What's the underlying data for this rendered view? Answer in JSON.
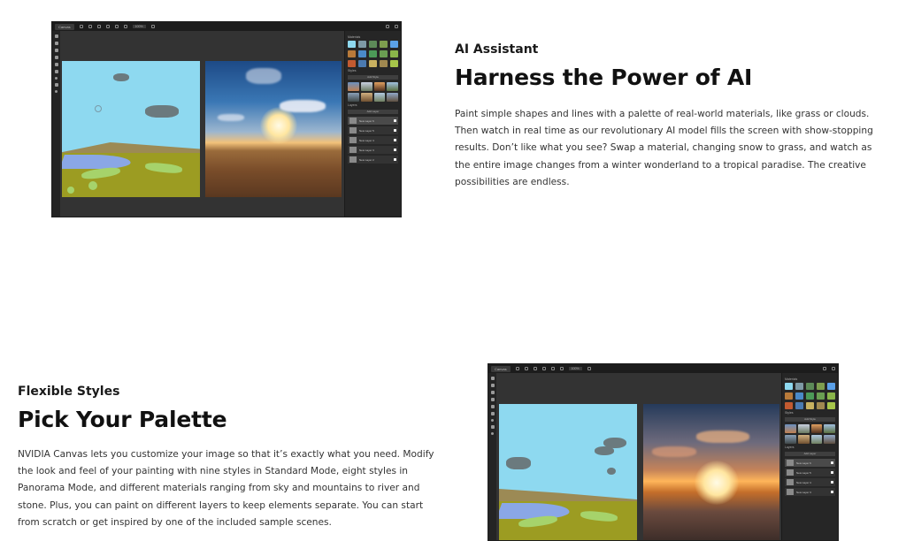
{
  "section1": {
    "eyebrow": "AI Assistant",
    "headline": "Harness the Power of AI",
    "body": "Paint simple shapes and lines with a palette of real-world materials, like grass or clouds. Then watch in real time as our revolutionary AI model fills the screen with show-stopping results. Don’t like what you see? Swap a material, changing snow to grass, and watch as the entire image changes from a winter wonderland to a tropical paradise. The creative possibilities are endless."
  },
  "section2": {
    "eyebrow": "Flexible Styles",
    "headline": "Pick Your Palette",
    "body": "NVIDIA Canvas lets you customize your image so that it’s exactly what you need. Modify the look and feel of your painting with nine styles in Standard Mode, eight styles in Panorama Mode, and different materials ranging from sky and mountains to river and stone. Plus, you can paint on different layers to keep elements separate. You can start from scratch or get inspired by one of the included sample scenes."
  },
  "app": {
    "name": "Canvas",
    "zoom": "100%",
    "materials_label": "Materials",
    "styles_label": "Styles",
    "layers_label": "Layers",
    "add_style_label": "Add Style",
    "add_layer_label": "Add Layer",
    "layers": [
      "New Layer 6",
      "New Layer 5",
      "New Layer 4",
      "New Layer 3",
      "New Layer 2"
    ]
  },
  "colors": {
    "sky": "#8ed9f0",
    "cloud": "#6b7a7e",
    "ground": "#9c9c22",
    "mountain": "#9c8a55",
    "water": "#8aa7e6",
    "grass": "#a6d36b",
    "selected_material": "#5aa0e8"
  }
}
